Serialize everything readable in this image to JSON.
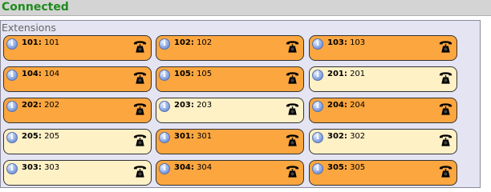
{
  "status": {
    "text": "Connected",
    "color": "#1f8a1f"
  },
  "panel": {
    "title": "Extensions"
  },
  "icons": {
    "info": "info-icon",
    "phone": "telephone-icon"
  },
  "colors": {
    "busy": "#fba63f",
    "idle": "#fff1c6"
  },
  "extensions": [
    {
      "number": "101:",
      "name": "101",
      "state": "busy"
    },
    {
      "number": "102:",
      "name": "102",
      "state": "busy"
    },
    {
      "number": "103:",
      "name": "103",
      "state": "busy"
    },
    {
      "number": "104:",
      "name": "104",
      "state": "busy"
    },
    {
      "number": "105:",
      "name": "105",
      "state": "busy"
    },
    {
      "number": "201:",
      "name": "201",
      "state": "idle"
    },
    {
      "number": "202:",
      "name": "202",
      "state": "busy"
    },
    {
      "number": "203:",
      "name": "203",
      "state": "idle"
    },
    {
      "number": "204:",
      "name": "204",
      "state": "busy"
    },
    {
      "number": "205:",
      "name": "205",
      "state": "idle"
    },
    {
      "number": "301:",
      "name": "301",
      "state": "busy"
    },
    {
      "number": "302:",
      "name": "302",
      "state": "idle"
    },
    {
      "number": "303:",
      "name": "303",
      "state": "idle"
    },
    {
      "number": "304:",
      "name": "304",
      "state": "busy"
    },
    {
      "number": "305:",
      "name": "305",
      "state": "busy"
    }
  ]
}
